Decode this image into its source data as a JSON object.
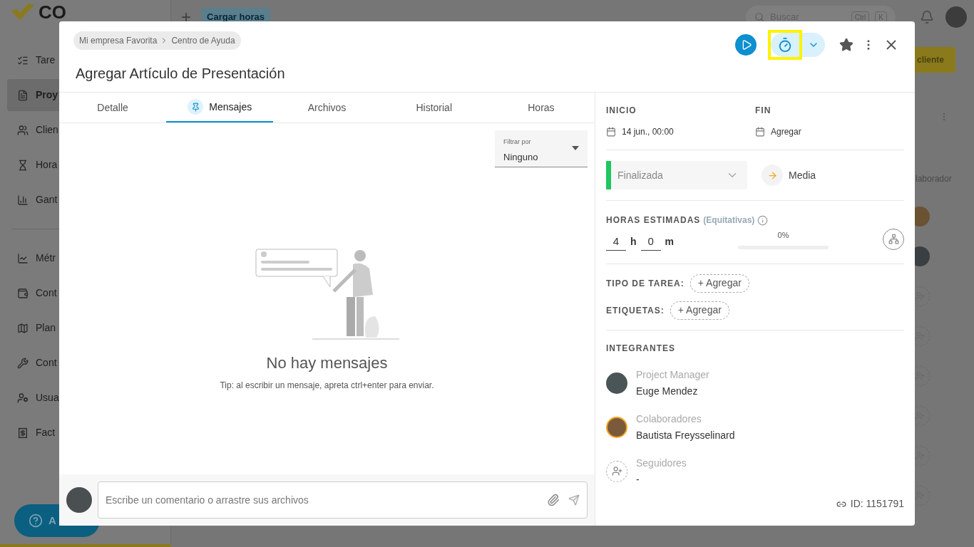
{
  "background": {
    "logo": "CO",
    "add_button": "+",
    "load_hours_button": "Cargar horas",
    "search": {
      "placeholder": "Buscar",
      "keys": [
        "Ctrl",
        "K"
      ]
    },
    "sidebar": [
      {
        "label": "Tare",
        "selected": false
      },
      {
        "label": "Proy",
        "selected": true
      },
      {
        "label": "Clien",
        "selected": false
      },
      {
        "label": "Hora",
        "selected": false
      },
      {
        "label": "Gant",
        "selected": false
      },
      {
        "label": "Métr",
        "selected": false
      },
      {
        "label": "Cont",
        "selected": false
      },
      {
        "label": "Plan",
        "selected": false
      },
      {
        "label": "Cont",
        "selected": false
      },
      {
        "label": "Usua",
        "selected": false
      },
      {
        "label": "Fact",
        "selected": false
      }
    ],
    "help_button": "A",
    "new_client_button": "cliente",
    "column_header": "laborador",
    "rows": [
      {
        "kind": "avatar"
      },
      {
        "kind": "avatar"
      },
      {
        "kind": "add"
      },
      {
        "kind": "add"
      },
      {
        "kind": "add"
      },
      {
        "kind": "add"
      },
      {
        "kind": "add"
      },
      {
        "kind": "add"
      }
    ]
  },
  "modal": {
    "breadcrumb": [
      "Mi empresa Favorita",
      "Centro de Ayuda"
    ],
    "title": "Agregar Artículo de Presentación",
    "timer_highlighted": true,
    "tabs": [
      {
        "label": "Detalle",
        "selected": false,
        "kind": "plain"
      },
      {
        "label": "Mensajes",
        "selected": true,
        "kind": "pinned"
      },
      {
        "label": "Archivos",
        "selected": false,
        "kind": "plain"
      },
      {
        "label": "Historial",
        "selected": false,
        "kind": "plain"
      },
      {
        "label": "Horas",
        "selected": false,
        "kind": "plain"
      }
    ],
    "filter": {
      "label": "Filtrar por",
      "value": "Ninguno"
    },
    "empty_state": {
      "title": "No hay mensajes",
      "tip": "Tip: al escribir un mensaje, apreta ctrl+enter para enviar."
    },
    "composer": {
      "placeholder": "Escribe un comentario o arrastre sus archivos"
    },
    "start": {
      "label": "INICIO",
      "value": "14 jun., 00:00"
    },
    "end": {
      "label": "FIN",
      "value": "Agregar"
    },
    "status": {
      "value": "Finalizada",
      "color": "#1ec65e"
    },
    "priority": {
      "value": "Media"
    },
    "estimate": {
      "label": "HORAS ESTIMADAS",
      "note": "(Equitativas)",
      "hours": "4",
      "hours_unit": "h",
      "minutes": "0",
      "minutes_unit": "m",
      "progress": "0%",
      "level": 0
    },
    "task_type": {
      "label": "TIPO DE TAREA:",
      "button": "+ Agregar"
    },
    "tags": {
      "label": "ETIQUETAS:",
      "button": "+ Agregar"
    },
    "members": {
      "label": "INTEGRANTES",
      "groups": [
        {
          "role": "Project Manager",
          "name": "Euge Mendez",
          "kind": "avatar"
        },
        {
          "role": "Colaboradores",
          "name": "Bautista Freysselinard",
          "kind": "avatar"
        },
        {
          "role": "Seguidores",
          "name": "-",
          "kind": "add"
        }
      ]
    },
    "id": "ID: 1151791"
  }
}
